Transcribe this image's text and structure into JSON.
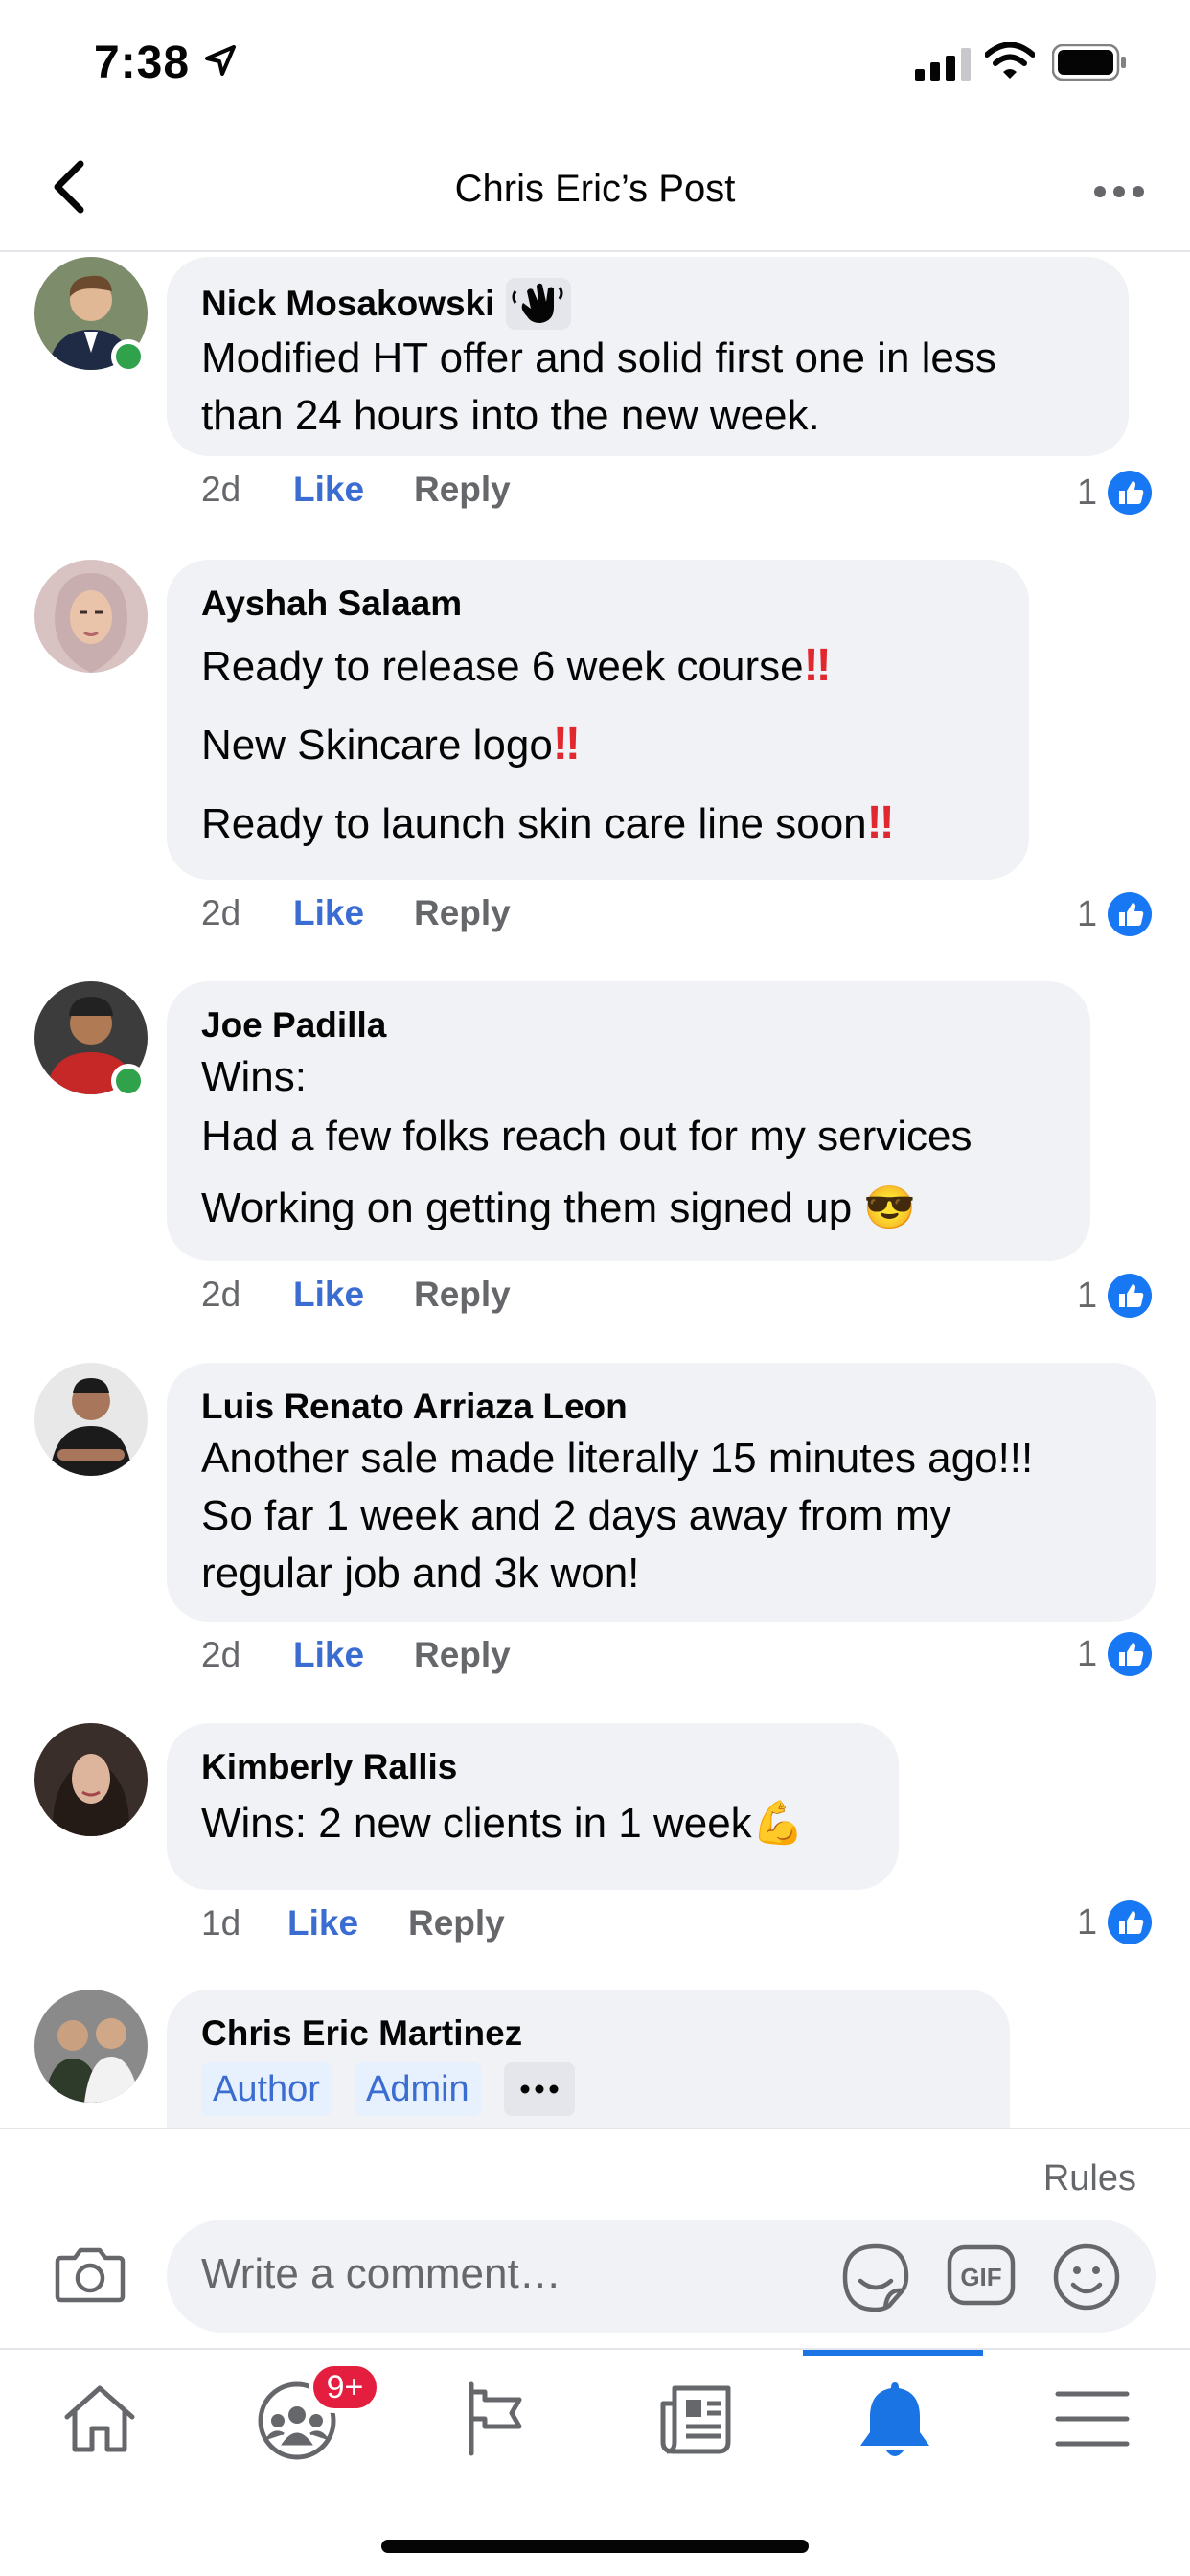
{
  "status_bar": {
    "time": "7:38"
  },
  "header": {
    "title": "Chris Eric’s Post"
  },
  "comments": [
    {
      "name": "Nick Mosakowski",
      "lines": [
        "Modified HT offer and solid first one in less",
        "than 24 hours into the new week."
      ],
      "ago": "2d",
      "like": "Like",
      "reply": "Reply",
      "reactions": "1"
    },
    {
      "name": "Ayshah Salaam",
      "lines": [
        "Ready to release 6 week course",
        "New Skincare logo",
        "Ready to launch skin care line soon"
      ],
      "emphasis": "‼",
      "ago": "2d",
      "like": "Like",
      "reply": "Reply",
      "reactions": "1"
    },
    {
      "name": "Joe Padilla",
      "lines": [
        "Wins:",
        "Had a few folks reach out for my services",
        "Working on getting them signed up 😎"
      ],
      "ago": "2d",
      "like": "Like",
      "reply": "Reply",
      "reactions": "1"
    },
    {
      "name": "Luis Renato Arriaza Leon",
      "lines": [
        "Another sale made literally 15 minutes ago!!!",
        "So far 1 week and 2 days away from my",
        "regular job and 3k won!"
      ],
      "ago": "2d",
      "like": "Like",
      "reply": "Reply",
      "reactions": "1"
    },
    {
      "name": "Kimberly Rallis",
      "lines": [
        "Wins: 2 new clients in 1 week💪"
      ],
      "ago": "1d",
      "like": "Like",
      "reply": "Reply",
      "reactions": "1"
    },
    {
      "name": "Chris Eric Martinez",
      "tags": [
        "Author",
        "Admin"
      ]
    }
  ],
  "composer": {
    "rules": "Rules",
    "placeholder": "Write a comment…"
  },
  "tabbar": {
    "groups_badge": "9+"
  },
  "colors": {
    "accent": "#1b74e4",
    "like": "#3a6cd1",
    "bubble": "#f0f2f5",
    "online": "#31a24c",
    "badge": "#e41e3f"
  }
}
